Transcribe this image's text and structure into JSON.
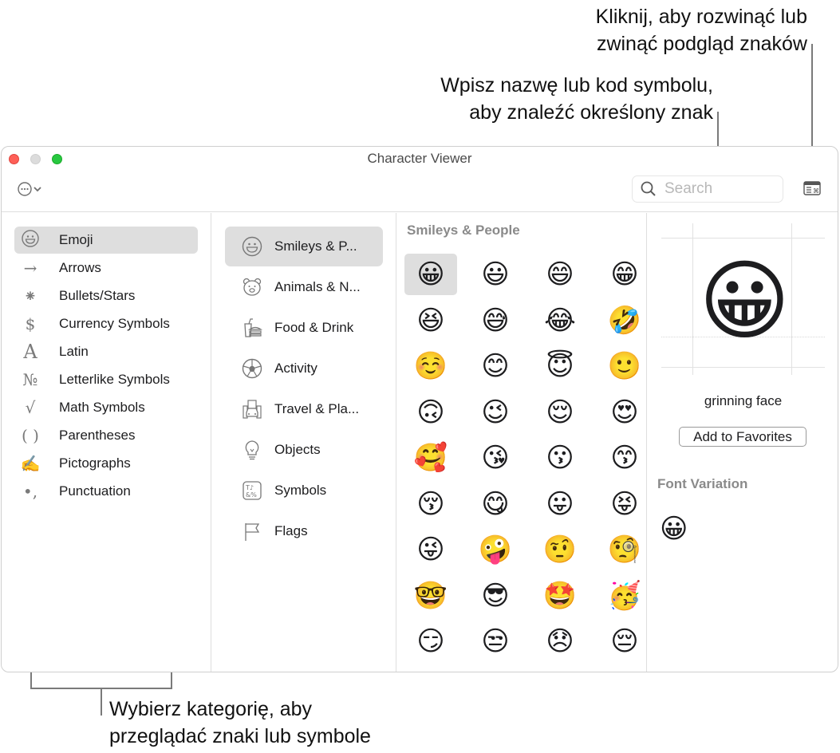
{
  "callouts": {
    "preview_toggle": [
      "Kliknij, aby rozwinąć lub",
      "zwinąć podgląd znaków"
    ],
    "search": [
      "Wpisz nazwę lub kod symbolu,",
      "aby znaleźć określony znak"
    ],
    "categories": [
      "Wybierz kategorię, aby",
      "przeglądać znaki lub symbole"
    ]
  },
  "window": {
    "title": "Character Viewer",
    "search_placeholder": "Search",
    "search_value": "",
    "action_icon": "ellipsis-circle-icon",
    "preview_toggle_icon": "keyboard-viewer-icon"
  },
  "categories": [
    {
      "label": "Emoji",
      "icon": "☺",
      "selected": true
    },
    {
      "label": "Arrows",
      "icon": "→"
    },
    {
      "label": "Bullets/Stars",
      "icon": "⁕"
    },
    {
      "label": "Currency Symbols",
      "icon": "$"
    },
    {
      "label": "Latin",
      "icon": "A"
    },
    {
      "label": "Letterlike Symbols",
      "icon": "№"
    },
    {
      "label": "Math Symbols",
      "icon": "√"
    },
    {
      "label": "Parentheses",
      "icon": "( )"
    },
    {
      "label": "Pictographs",
      "icon": "✍"
    },
    {
      "label": "Punctuation",
      "icon": "•,"
    }
  ],
  "subcategories": [
    {
      "label": "Smileys & P...",
      "icon": "smiley-icon",
      "selected": true
    },
    {
      "label": "Animals & N...",
      "icon": "bear-icon"
    },
    {
      "label": "Food & Drink",
      "icon": "burger-drink-icon"
    },
    {
      "label": "Activity",
      "icon": "soccer-ball-icon"
    },
    {
      "label": "Travel & Pla...",
      "icon": "building-car-icon"
    },
    {
      "label": "Objects",
      "icon": "lightbulb-icon"
    },
    {
      "label": "Symbols",
      "icon": "symbols-icon"
    },
    {
      "label": "Flags",
      "icon": "flag-icon"
    }
  ],
  "grid": {
    "title": "Smileys & People",
    "emojis": [
      "😀",
      "😃",
      "😄",
      "😁",
      "😆",
      "😅",
      "😂",
      "🤣",
      "☺️",
      "😊",
      "😇",
      "🙂",
      "🙃",
      "😉",
      "😌",
      "😍",
      "🥰",
      "😘",
      "😗",
      "😙",
      "😚",
      "😋",
      "😛",
      "😝",
      "😜",
      "🤪",
      "🤨",
      "🧐",
      "🤓",
      "😎",
      "🤩",
      "🥳",
      "😏",
      "😒",
      "😞",
      "😔"
    ],
    "selected_index": 0
  },
  "preview": {
    "emoji": "😀",
    "name": "grinning face",
    "add_favorites_label": "Add to Favorites",
    "font_variation_title": "Font Variation",
    "font_variations": [
      "😀"
    ]
  }
}
